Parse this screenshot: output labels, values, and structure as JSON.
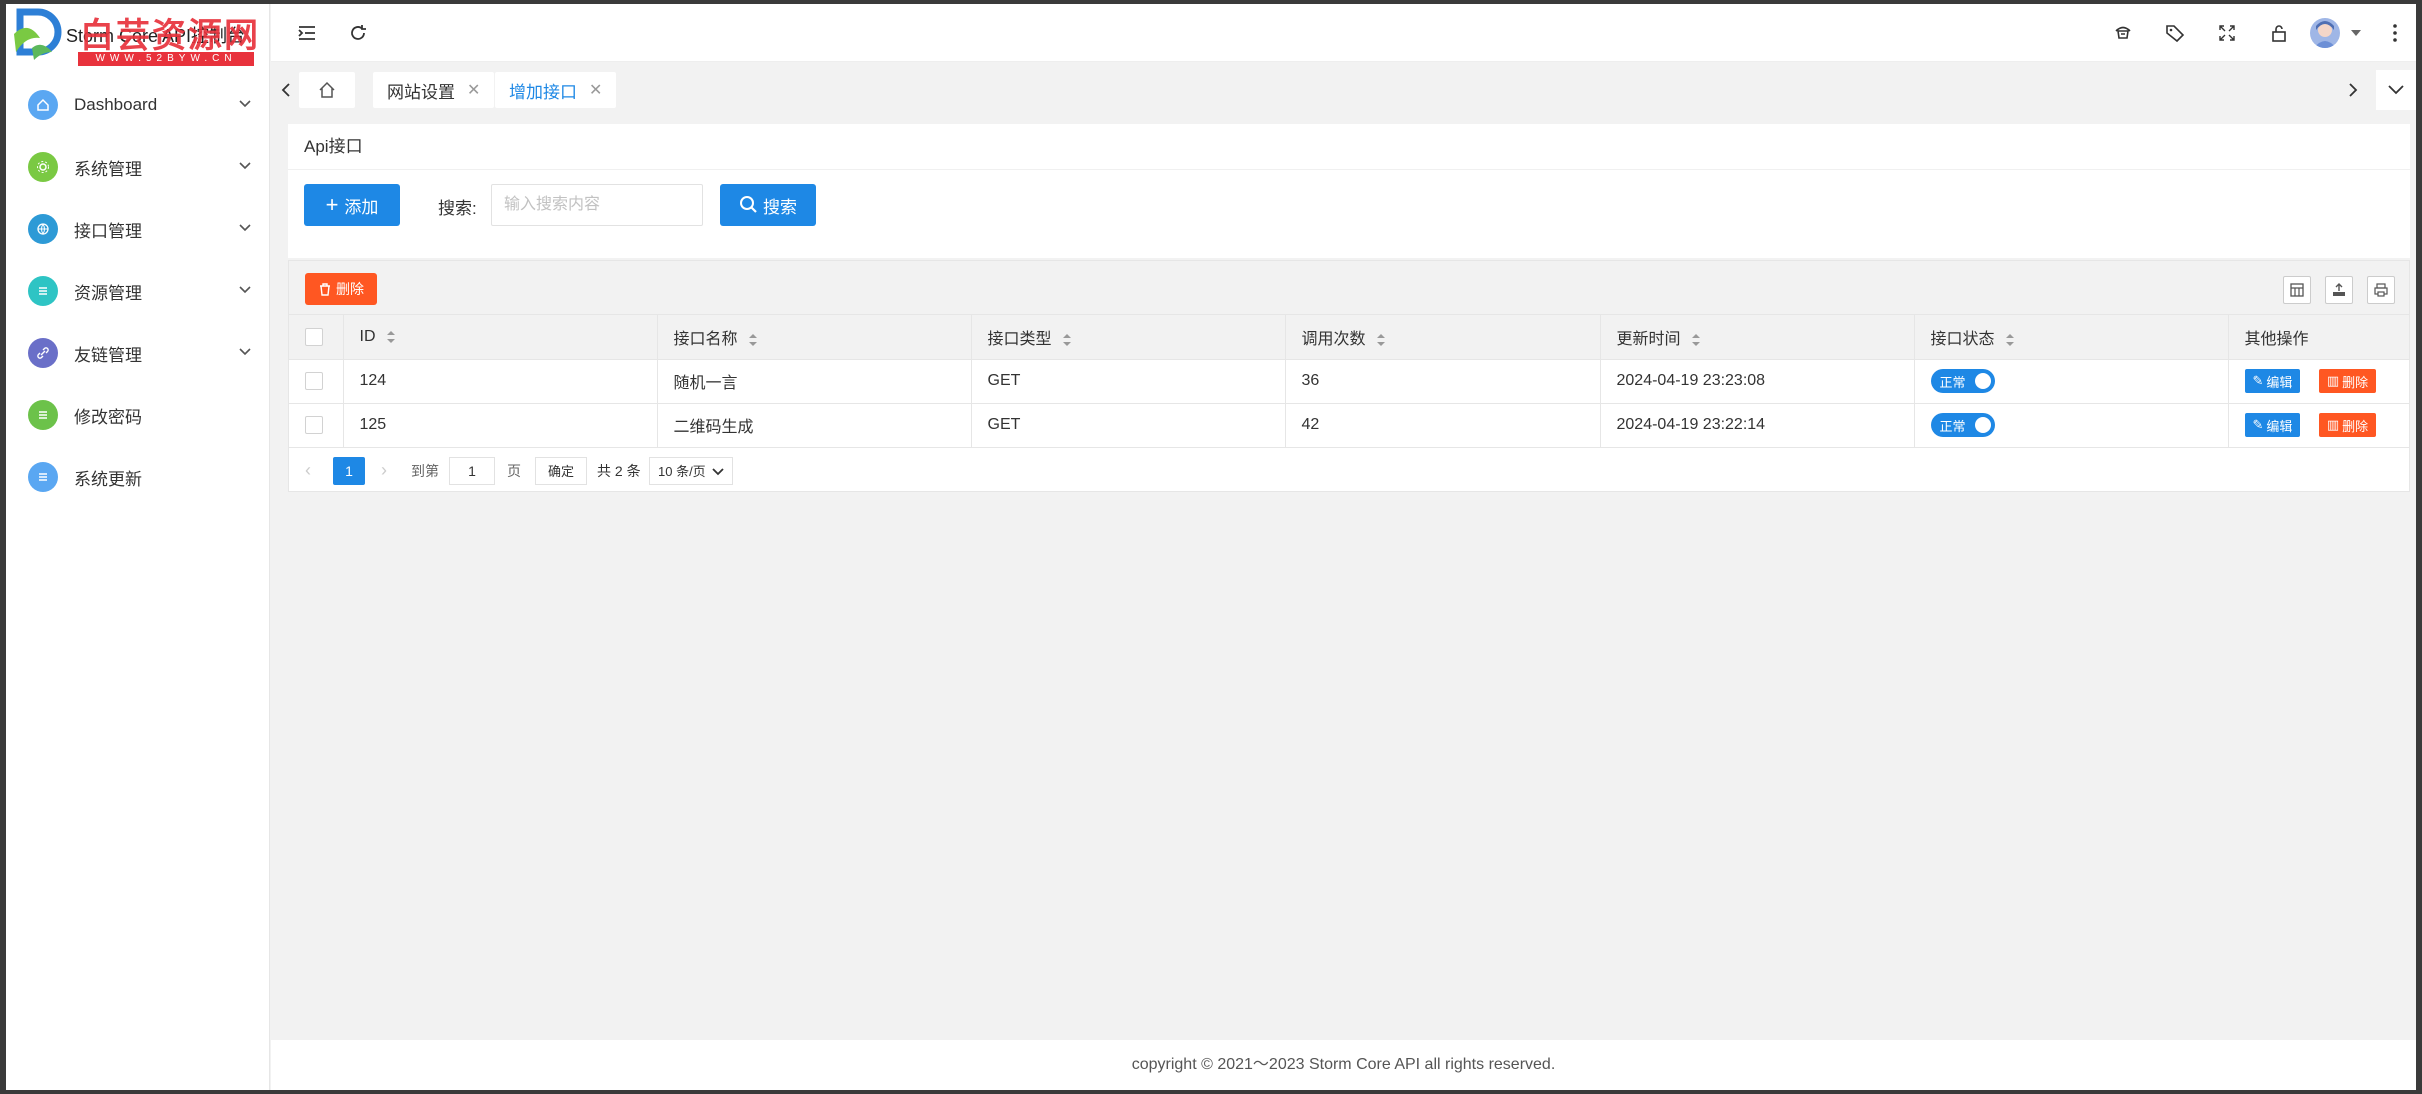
{
  "app": {
    "title": "Storm Core API控制台",
    "watermark_main": "白芸资源网",
    "watermark_sub": "WWW.52BYW.CN"
  },
  "sidebar": {
    "items": [
      {
        "label": "Dashboard",
        "icon": "home-icon",
        "color": "#5aa7f2",
        "has_children": true
      },
      {
        "label": "系统管理",
        "icon": "gear-icon",
        "color": "#7ac943",
        "has_children": true
      },
      {
        "label": "接口管理",
        "icon": "globe-icon",
        "color": "#2d9ad6",
        "has_children": true
      },
      {
        "label": "资源管理",
        "icon": "list-icon",
        "color": "#2ec4c4",
        "has_children": true
      },
      {
        "label": "友链管理",
        "icon": "link-icon",
        "color": "#6a6fc8",
        "has_children": true
      },
      {
        "label": "修改密码",
        "icon": "list-icon",
        "color": "#6cc24a",
        "has_children": false
      },
      {
        "label": "系统更新",
        "icon": "list-icon",
        "color": "#5aa7f2",
        "has_children": false
      }
    ]
  },
  "tabs": [
    {
      "label": "网站设置",
      "active": false
    },
    {
      "label": "增加接口",
      "active": true
    }
  ],
  "panel": {
    "title": "Api接口",
    "add_label": "添加",
    "search_label": "搜索:",
    "search_placeholder": "输入搜索内容",
    "search_button": "搜索"
  },
  "table": {
    "delete_label": "删除",
    "columns": [
      "ID",
      "接口名称",
      "接口类型",
      "调用次数",
      "更新时间",
      "接口状态",
      "其他操作"
    ],
    "rows": [
      {
        "id": "124",
        "name": "随机一言",
        "type": "GET",
        "calls": "36",
        "updated": "2024-04-19 23:23:08",
        "status": "正常"
      },
      {
        "id": "125",
        "name": "二维码生成",
        "type": "GET",
        "calls": "42",
        "updated": "2024-04-19 23:22:14",
        "status": "正常"
      }
    ],
    "edit_label": "编辑",
    "row_delete_label": "删除"
  },
  "pagination": {
    "current": "1",
    "goto_label": "到第",
    "goto_value": "1",
    "page_unit": "页",
    "confirm": "确定",
    "total": "共 2 条",
    "page_size": "10 条/页"
  },
  "footer": {
    "text": "copyright © 2021～2023 Storm Core API all rights reserved."
  },
  "colors": {
    "primary": "#1e88e5",
    "danger": "#ff5722"
  }
}
